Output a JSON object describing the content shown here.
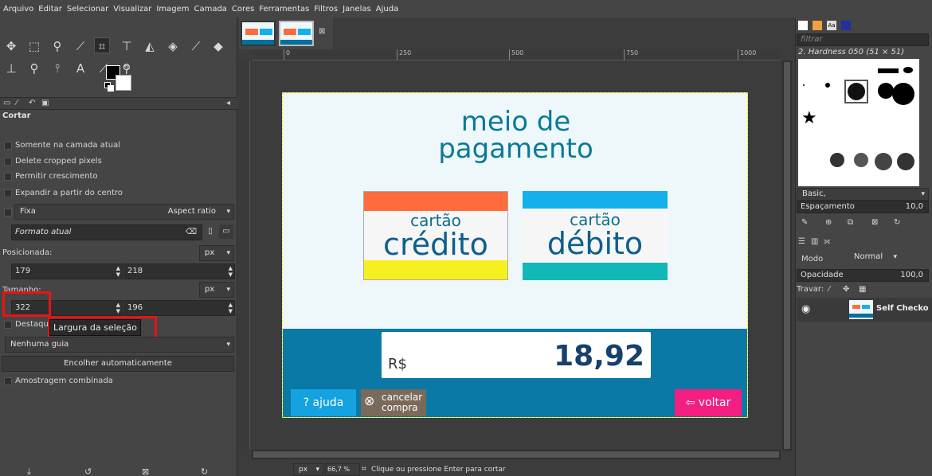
{
  "menubar": {
    "items": [
      "Arquivo",
      "Editar",
      "Selecionar",
      "Visualizar",
      "Imagem",
      "Camada",
      "Cores",
      "Ferramentas",
      "Filtros",
      "Janelas",
      "Ajuda"
    ]
  },
  "tool_options": {
    "title": "Cortar",
    "only_current_layer": "Somente na camada atual",
    "delete_cropped": "Delete cropped pixels",
    "allow_growing": "Permitir crescimento",
    "expand_center": "Expandir a partir do centro",
    "fixed_label": "Fixa",
    "fixed_mode": "Aspect ratio",
    "current_format": "Formato atual",
    "position_label": "Posicionada:",
    "position_unit": "px",
    "position_x": "179",
    "position_y": "218",
    "size_label": "Tamanho:",
    "size_unit": "px",
    "size_w": "322",
    "size_h": "196",
    "highlight_label": "Destaque",
    "tooltip": "Largura da seleção",
    "guide": "Nenhuma guia",
    "autoshrink": "Encolher automaticamente",
    "sample_merged": "Amostragem combinada"
  },
  "rulers": {
    "h": [
      "0",
      "250",
      "500",
      "750",
      "1000"
    ]
  },
  "image": {
    "title_line1": "meio de",
    "title_line2": "pagamento",
    "card_credit_small": "cartão",
    "card_credit_big": "crédito",
    "card_debit_small": "cartão",
    "card_debit_big": "débito",
    "currency": "R$",
    "price": "18,92",
    "help_button": "? ajuda",
    "cancel_line1": "cancelar",
    "cancel_line2": "compra",
    "back_button": "voltar",
    "colors": {
      "background": "#eef8fb",
      "title": "#0b7a96",
      "credit_band": "#ff6b3d",
      "credit_bottom": "#f7f020",
      "debit_band": "#14b0ec",
      "debit_bottom": "#12b8b8",
      "footer": "#0a79a6",
      "help": "#14a2e0",
      "cancel": "#7a6a5a",
      "back": "#f31e82"
    }
  },
  "statusbar": {
    "unit": "px",
    "zoom": "66,7 %",
    "message": "Clique ou pressione Enter para cortar"
  },
  "right_dock": {
    "filter_placeholder": "filtrar",
    "brush_name": "2. Hardness 050 (51 × 51)",
    "brush_set": "Basic,",
    "spacing_label": "Espaçamento",
    "spacing_value": "10,0",
    "mode_label": "Modo",
    "mode_value": "Normal",
    "opacity_label": "Opacidade",
    "opacity_value": "100,0",
    "lock_label": "Travar:",
    "layer_name": "Self Checko"
  }
}
